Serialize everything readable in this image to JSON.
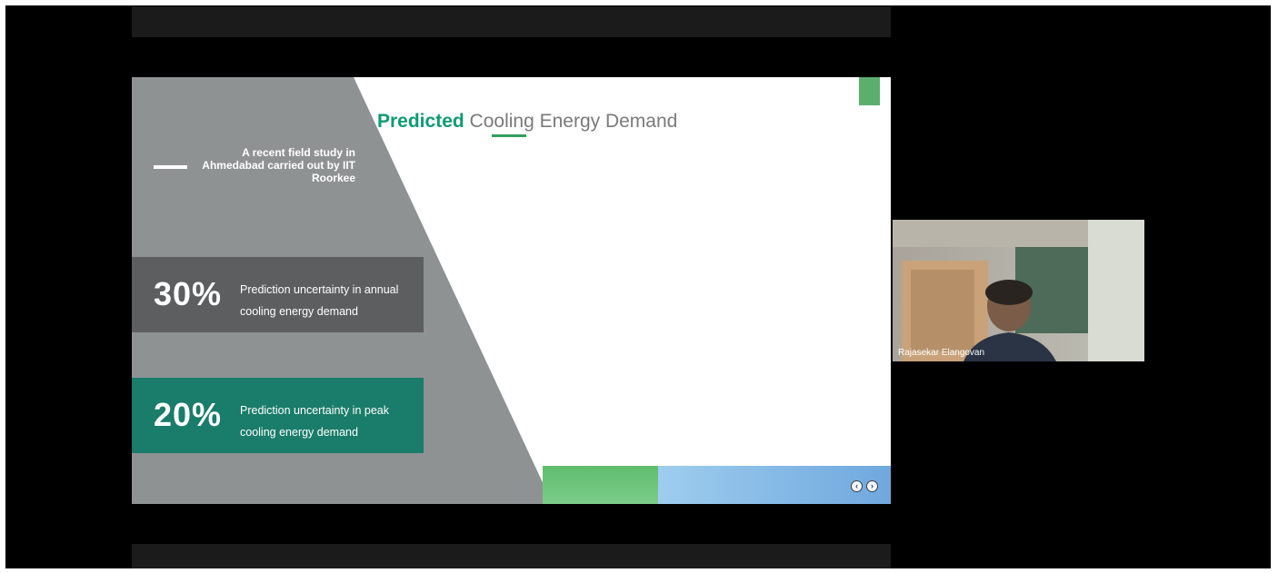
{
  "slide": {
    "title_bold": "Predicted",
    "title_rest": "Cooling Energy Demand",
    "study_text": "A recent field study in Ahmedabad carried out by IIT Roorkee",
    "stats": [
      {
        "percent": "30%",
        "description": "Prediction uncertainty in annual cooling energy demand"
      },
      {
        "percent": "20%",
        "description": "Prediction uncertainty in peak cooling energy demand"
      }
    ],
    "nav": {
      "prev_icon": "chevron-left-icon",
      "next_icon": "chevron-right-icon"
    }
  },
  "participant": {
    "name": "Rajasekar Elangovan"
  },
  "colors": {
    "accent_green": "#0f9a73",
    "panel_gray": "#8f9293",
    "stat_gray": "#5c5e5f",
    "stat_teal": "#1a7c6a"
  }
}
